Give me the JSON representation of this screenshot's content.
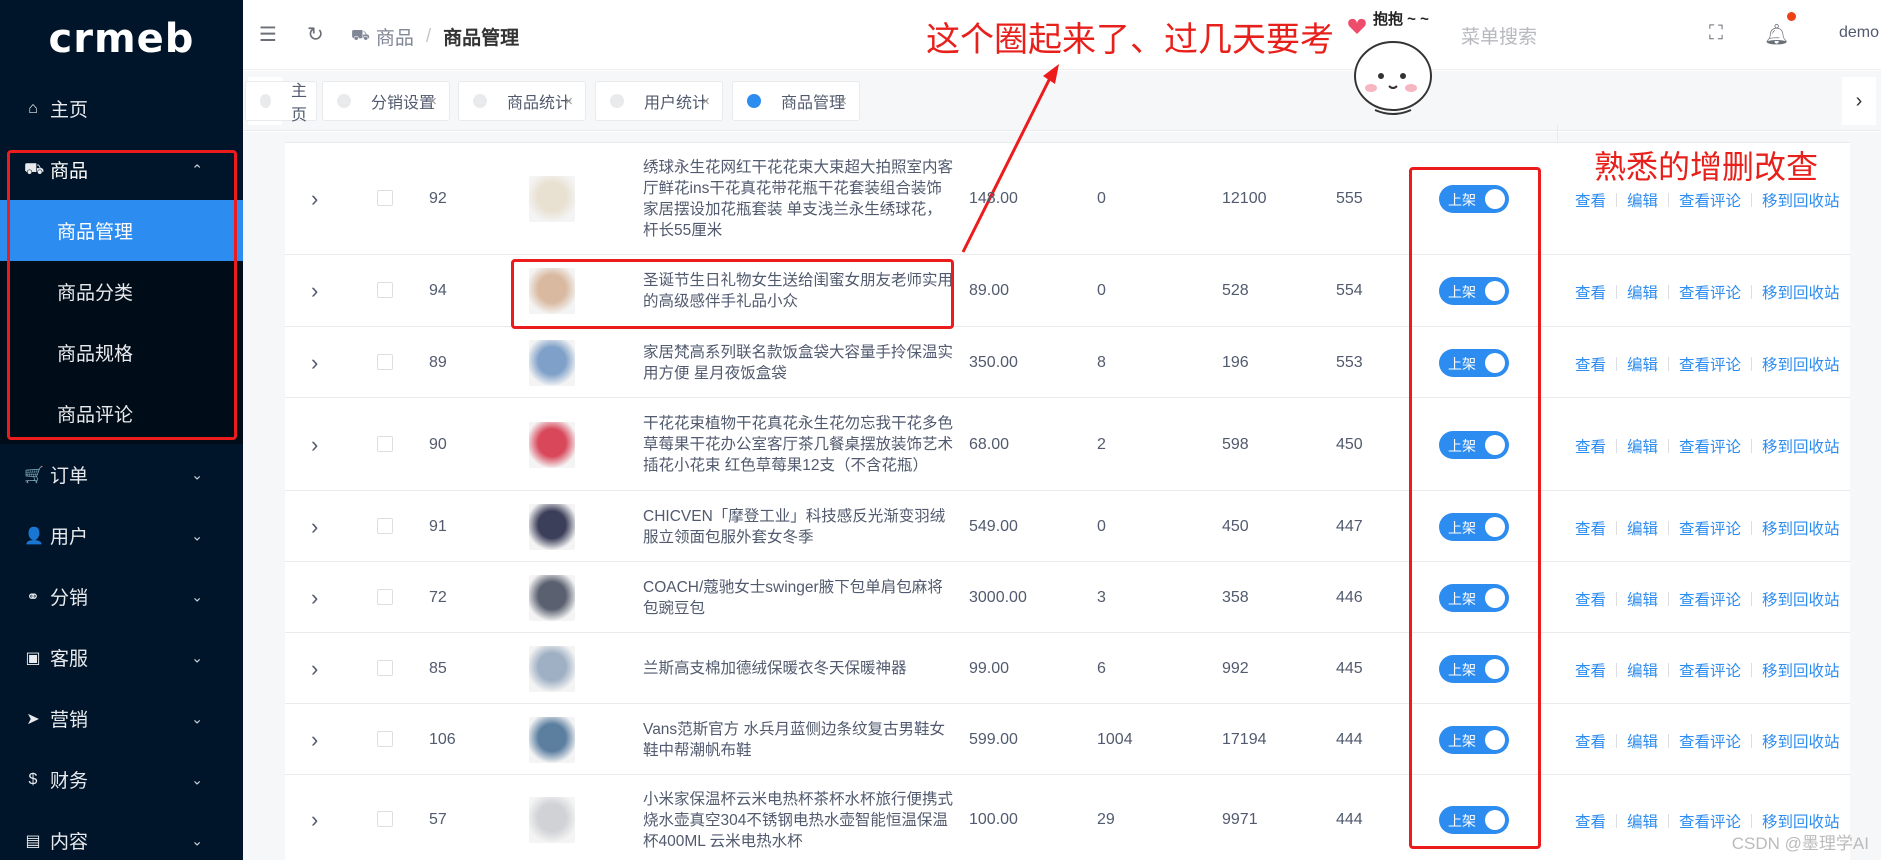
{
  "logo": "crmeb",
  "sidebar": {
    "items": [
      {
        "label": "主页",
        "icon": "home-icon",
        "glyph": "⌂"
      },
      {
        "label": "商品",
        "icon": "bag-icon",
        "glyph": "⛟",
        "open": true,
        "children": [
          "商品管理",
          "商品分类",
          "商品规格",
          "商品评论"
        ]
      },
      {
        "label": "订单",
        "icon": "cart-icon",
        "glyph": "🛒"
      },
      {
        "label": "用户",
        "icon": "user-icon",
        "glyph": "👤"
      },
      {
        "label": "分销",
        "icon": "distribution-icon",
        "glyph": "⚭"
      },
      {
        "label": "客服",
        "icon": "chat-icon",
        "glyph": "▣"
      },
      {
        "label": "营销",
        "icon": "send-icon",
        "glyph": "➤"
      },
      {
        "label": "财务",
        "icon": "dollar-icon",
        "glyph": "$"
      },
      {
        "label": "内容",
        "icon": "book-icon",
        "glyph": "▤"
      }
    ],
    "active_child": "商品管理"
  },
  "header": {
    "breadcrumb": [
      "商品",
      "商品管理"
    ],
    "menu_search": "菜单搜索",
    "user": "demo"
  },
  "tabs": [
    {
      "label": "主页",
      "closable": false,
      "active": false
    },
    {
      "label": "分销设置",
      "closable": true,
      "active": false
    },
    {
      "label": "商品统计",
      "closable": true,
      "active": false
    },
    {
      "label": "用户统计",
      "closable": true,
      "active": false
    },
    {
      "label": "商品管理",
      "closable": true,
      "active": true
    }
  ],
  "table": {
    "switch_label": "上架",
    "actions": [
      "查看",
      "编辑",
      "查看评论",
      "移到回收站"
    ],
    "rows": [
      {
        "id": "92",
        "name": "绣球永生花网红干花花束大束超大拍照室内客厅鲜花ins干花真花带花瓶干花套装组合装饰家居摆设加花瓶套装 单支浅兰永生绣球花，杆长55厘米",
        "price": "148.00",
        "sales": "0",
        "stock": "12100",
        "sort": "555",
        "thumb": "#e8e0d0"
      },
      {
        "id": "94",
        "name": "圣诞节生日礼物女生送给闺蜜女朋友老师实用的高级感伴手礼品小众",
        "price": "89.00",
        "sales": "0",
        "stock": "528",
        "sort": "554",
        "thumb": "#d9b9a0"
      },
      {
        "id": "89",
        "name": "家居梵高系列联名款饭盒袋大容量手拎保温实用方便 星月夜饭盒袋",
        "price": "350.00",
        "sales": "8",
        "stock": "196",
        "sort": "553",
        "thumb": "#7fa0c8"
      },
      {
        "id": "90",
        "name": "干花花束植物干花真花永生花勿忘我干花多色草莓果干花办公室客厅茶几餐桌摆放装饰艺术插花小花束 红色草莓果12支（不含花瓶）",
        "price": "68.00",
        "sales": "2",
        "stock": "598",
        "sort": "450",
        "thumb": "#d8475a"
      },
      {
        "id": "91",
        "name": "CHICVEN「摩登工业」科技感反光渐变羽绒服立领面包服外套女冬季",
        "price": "549.00",
        "sales": "0",
        "stock": "450",
        "sort": "447",
        "thumb": "#3c3f5a"
      },
      {
        "id": "72",
        "name": "COACH/蔻驰女士swinger腋下包单肩包麻将包豌豆包",
        "price": "3000.00",
        "sales": "3",
        "stock": "358",
        "sort": "446",
        "thumb": "#5a6070"
      },
      {
        "id": "85",
        "name": "兰斯高支棉加德绒保暖衣冬天保暖神器",
        "price": "99.00",
        "sales": "6",
        "stock": "992",
        "sort": "445",
        "thumb": "#9fb0c4"
      },
      {
        "id": "106",
        "name": "Vans范斯官方 水兵月蓝侧边条纹复古男鞋女鞋中帮潮帆布鞋",
        "price": "599.00",
        "sales": "1004",
        "stock": "17194",
        "sort": "444",
        "thumb": "#5c7fa0"
      },
      {
        "id": "57",
        "name": "小米家保温杯云米电热杯茶杯水杯旅行便携式烧水壶真空304不锈钢电热水壶智能恒温保温杯400ML 云米电热水杯",
        "price": "100.00",
        "sales": "29",
        "stock": "9971",
        "sort": "444",
        "thumb": "#d0d2d6"
      }
    ]
  },
  "annotations": {
    "top_note": "这个圈起来了、过几天要考",
    "right_note": "熟悉的增删改查",
    "sticker_text": "抱抱 ~ ~"
  },
  "watermark": "CSDN @墨理学AI",
  "colors": {
    "sidebar_bg": "#001529",
    "accent": "#2d8cf0",
    "annotation": "#e8201b"
  }
}
